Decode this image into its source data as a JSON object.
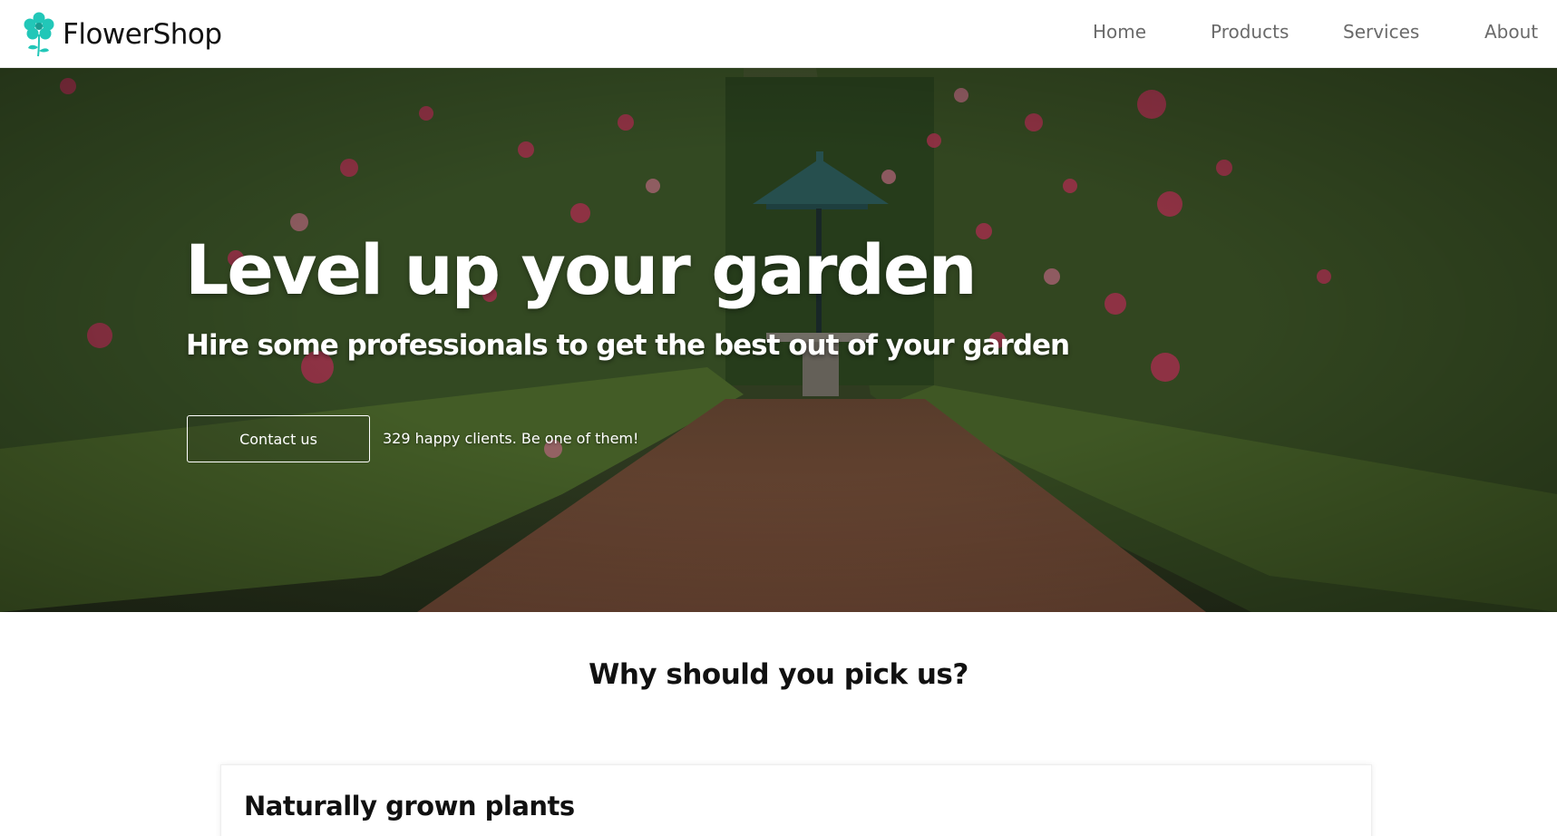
{
  "header": {
    "brand_name": "FlowerShop",
    "logo_icon": "flower-icon",
    "nav": [
      {
        "label": "Home"
      },
      {
        "label": "Products"
      },
      {
        "label": "Services"
      },
      {
        "label": "About"
      }
    ]
  },
  "hero": {
    "title": "Level up your garden",
    "subtitle": "Hire some professionals to get the best out of your garden",
    "cta_label": "Contact us",
    "clients_text": "329 happy clients. Be one of them!"
  },
  "why": {
    "heading": "Why should you pick us?",
    "cards": [
      {
        "title": "Naturally grown plants"
      }
    ]
  },
  "colors": {
    "brand_accent": "#22c7b8",
    "nav_text": "#6a6a6a",
    "hero_text": "#ffffff"
  }
}
